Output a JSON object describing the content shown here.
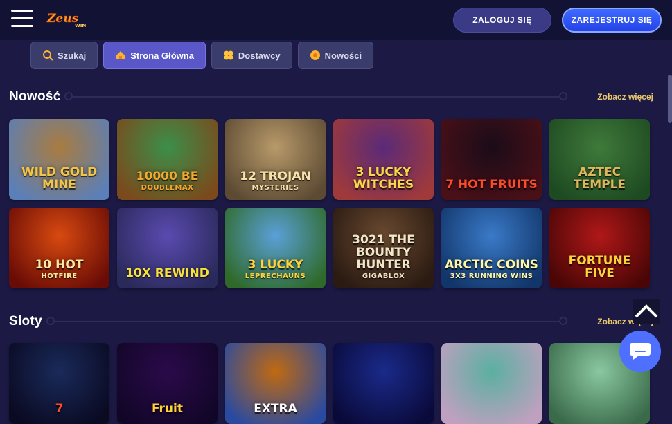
{
  "header": {
    "logo_text": "Zeus",
    "logo_sub": "WIN",
    "login_label": "ZALOGUJ SIĘ",
    "register_label": "ZAREJESTRUJ SIĘ"
  },
  "tabs": [
    {
      "label": "Szukaj",
      "icon": "search-icon",
      "active": false
    },
    {
      "label": "Strona Główna",
      "icon": "home-icon",
      "active": true
    },
    {
      "label": "Dostawcy",
      "icon": "clover-icon",
      "active": false
    },
    {
      "label": "Nowości",
      "icon": "star-burst-icon",
      "active": false
    }
  ],
  "sections": [
    {
      "title": "Nowość",
      "see_more": "Zobacz więcej",
      "games": [
        {
          "title": "WILD GOLD MINE",
          "sub": "",
          "colors": [
            "#a97c3f",
            "#5b7fb8"
          ],
          "text_color": "#f4c542"
        },
        {
          "title": "10000 BE",
          "sub": "DOUBLEMAX",
          "colors": [
            "#3b8f4a",
            "#7b4a1c"
          ],
          "text_color": "#f0a830"
        },
        {
          "title": "12 TROJAN",
          "sub": "MYSTERIES",
          "colors": [
            "#b89a6a",
            "#5c4a33"
          ],
          "text_color": "#f6e1a8"
        },
        {
          "title": "3 LUCKY WITCHES",
          "sub": "",
          "colors": [
            "#5a2a78",
            "#a03a3a"
          ],
          "text_color": "#f7d84a"
        },
        {
          "title": "7 HOT FRUITS",
          "sub": "",
          "colors": [
            "#1a0c18",
            "#4a1018"
          ],
          "text_color": "#ff4a2a"
        },
        {
          "title": "AZTEC TEMPLE",
          "sub": "",
          "colors": [
            "#3f7a3a",
            "#1e4a22"
          ],
          "text_color": "#e0b65a"
        },
        {
          "title": "10 HOT",
          "sub": "HOTFIRE",
          "colors": [
            "#d84a10",
            "#6a0c06"
          ],
          "text_color": "#ffe9a0"
        },
        {
          "title": "10X REWIND",
          "sub": "",
          "colors": [
            "#5a4ab0",
            "#2a2a5a"
          ],
          "text_color": "#f8e13a"
        },
        {
          "title": "3 LUCKY",
          "sub": "LEPRECHAUNS",
          "colors": [
            "#5aa0d8",
            "#2f6a2a"
          ],
          "text_color": "#ffd23a"
        },
        {
          "title": "3021 THE BOUNTY HUNTER",
          "sub": "GIGABLOX",
          "colors": [
            "#6a4a30",
            "#2a1a12"
          ],
          "text_color": "#f2e6c8"
        },
        {
          "title": "ARCTIC COINS",
          "sub": "3X3 RUNNING WINS",
          "colors": [
            "#3a7ac8",
            "#12366a"
          ],
          "text_color": "#fff6a8"
        },
        {
          "title": "FORTUNE FIVE",
          "sub": "",
          "colors": [
            "#b01818",
            "#4a0606"
          ],
          "text_color": "#ffd23a"
        }
      ]
    },
    {
      "title": "Sloty",
      "see_more": "Zobacz więcej",
      "games": [
        {
          "title": "7",
          "sub": "",
          "colors": [
            "#1a2a5a",
            "#0a0a22"
          ],
          "text_color": "#ff4a2a"
        },
        {
          "title": "Fruit",
          "sub": "",
          "colors": [
            "#2a0a4a",
            "#120628"
          ],
          "text_color": "#ffd23a"
        },
        {
          "title": "EXTRA",
          "sub": "",
          "colors": [
            "#c06a10",
            "#2a4aa0"
          ],
          "text_color": "#ffffff"
        },
        {
          "title": "",
          "sub": "",
          "colors": [
            "#1a2a8a",
            "#0a0a3a"
          ],
          "text_color": "#ffd23a"
        },
        {
          "title": "",
          "sub": "",
          "colors": [
            "#5ab0a0",
            "#c0a0c0"
          ],
          "text_color": "#ffffff"
        },
        {
          "title": "",
          "sub": "",
          "colors": [
            "#8ac8a0",
            "#3a6a4a"
          ],
          "text_color": "#ffffff"
        }
      ]
    }
  ],
  "colors": {
    "accent": "#5a57c9",
    "link": "#e8c76a",
    "register": "#2442e8"
  }
}
